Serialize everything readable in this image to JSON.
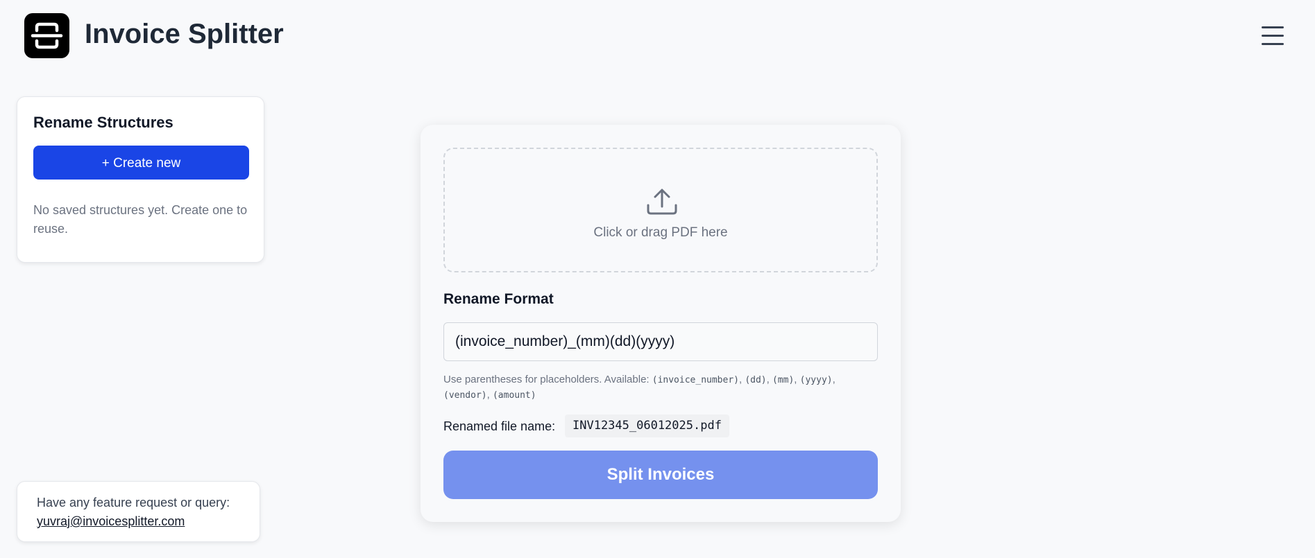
{
  "header": {
    "app_title": "Invoice Splitter",
    "logo_icon": "scan-document-icon",
    "menu_icon": "hamburger-menu-icon"
  },
  "sidebar": {
    "title": "Rename Structures",
    "create_button_label": "+ Create new",
    "empty_message": "No saved structures yet. Create one to reuse."
  },
  "feedback": {
    "text": "Have any feature request or query:",
    "email": "yuvraj@invoicesplitter.com"
  },
  "main": {
    "dropzone": {
      "icon": "upload-icon",
      "text": "Click or drag PDF here"
    },
    "rename_format": {
      "label": "Rename Format",
      "value": "(invoice_number)_(mm)(dd)(yyyy)"
    },
    "hint": {
      "prefix": "Use parentheses for placeholders. Available: ",
      "placeholders": [
        "(invoice_number)",
        "(dd)",
        "(mm)",
        "(yyyy)",
        "(vendor)",
        "(amount)"
      ]
    },
    "renamed": {
      "label": "Renamed file name:",
      "value": "INV12345_06012025.pdf"
    },
    "split_button_label": "Split Invoices"
  },
  "colors": {
    "primary_button": "#1a45e6",
    "split_button": "#7591ee",
    "background": "#f8f9fb"
  }
}
